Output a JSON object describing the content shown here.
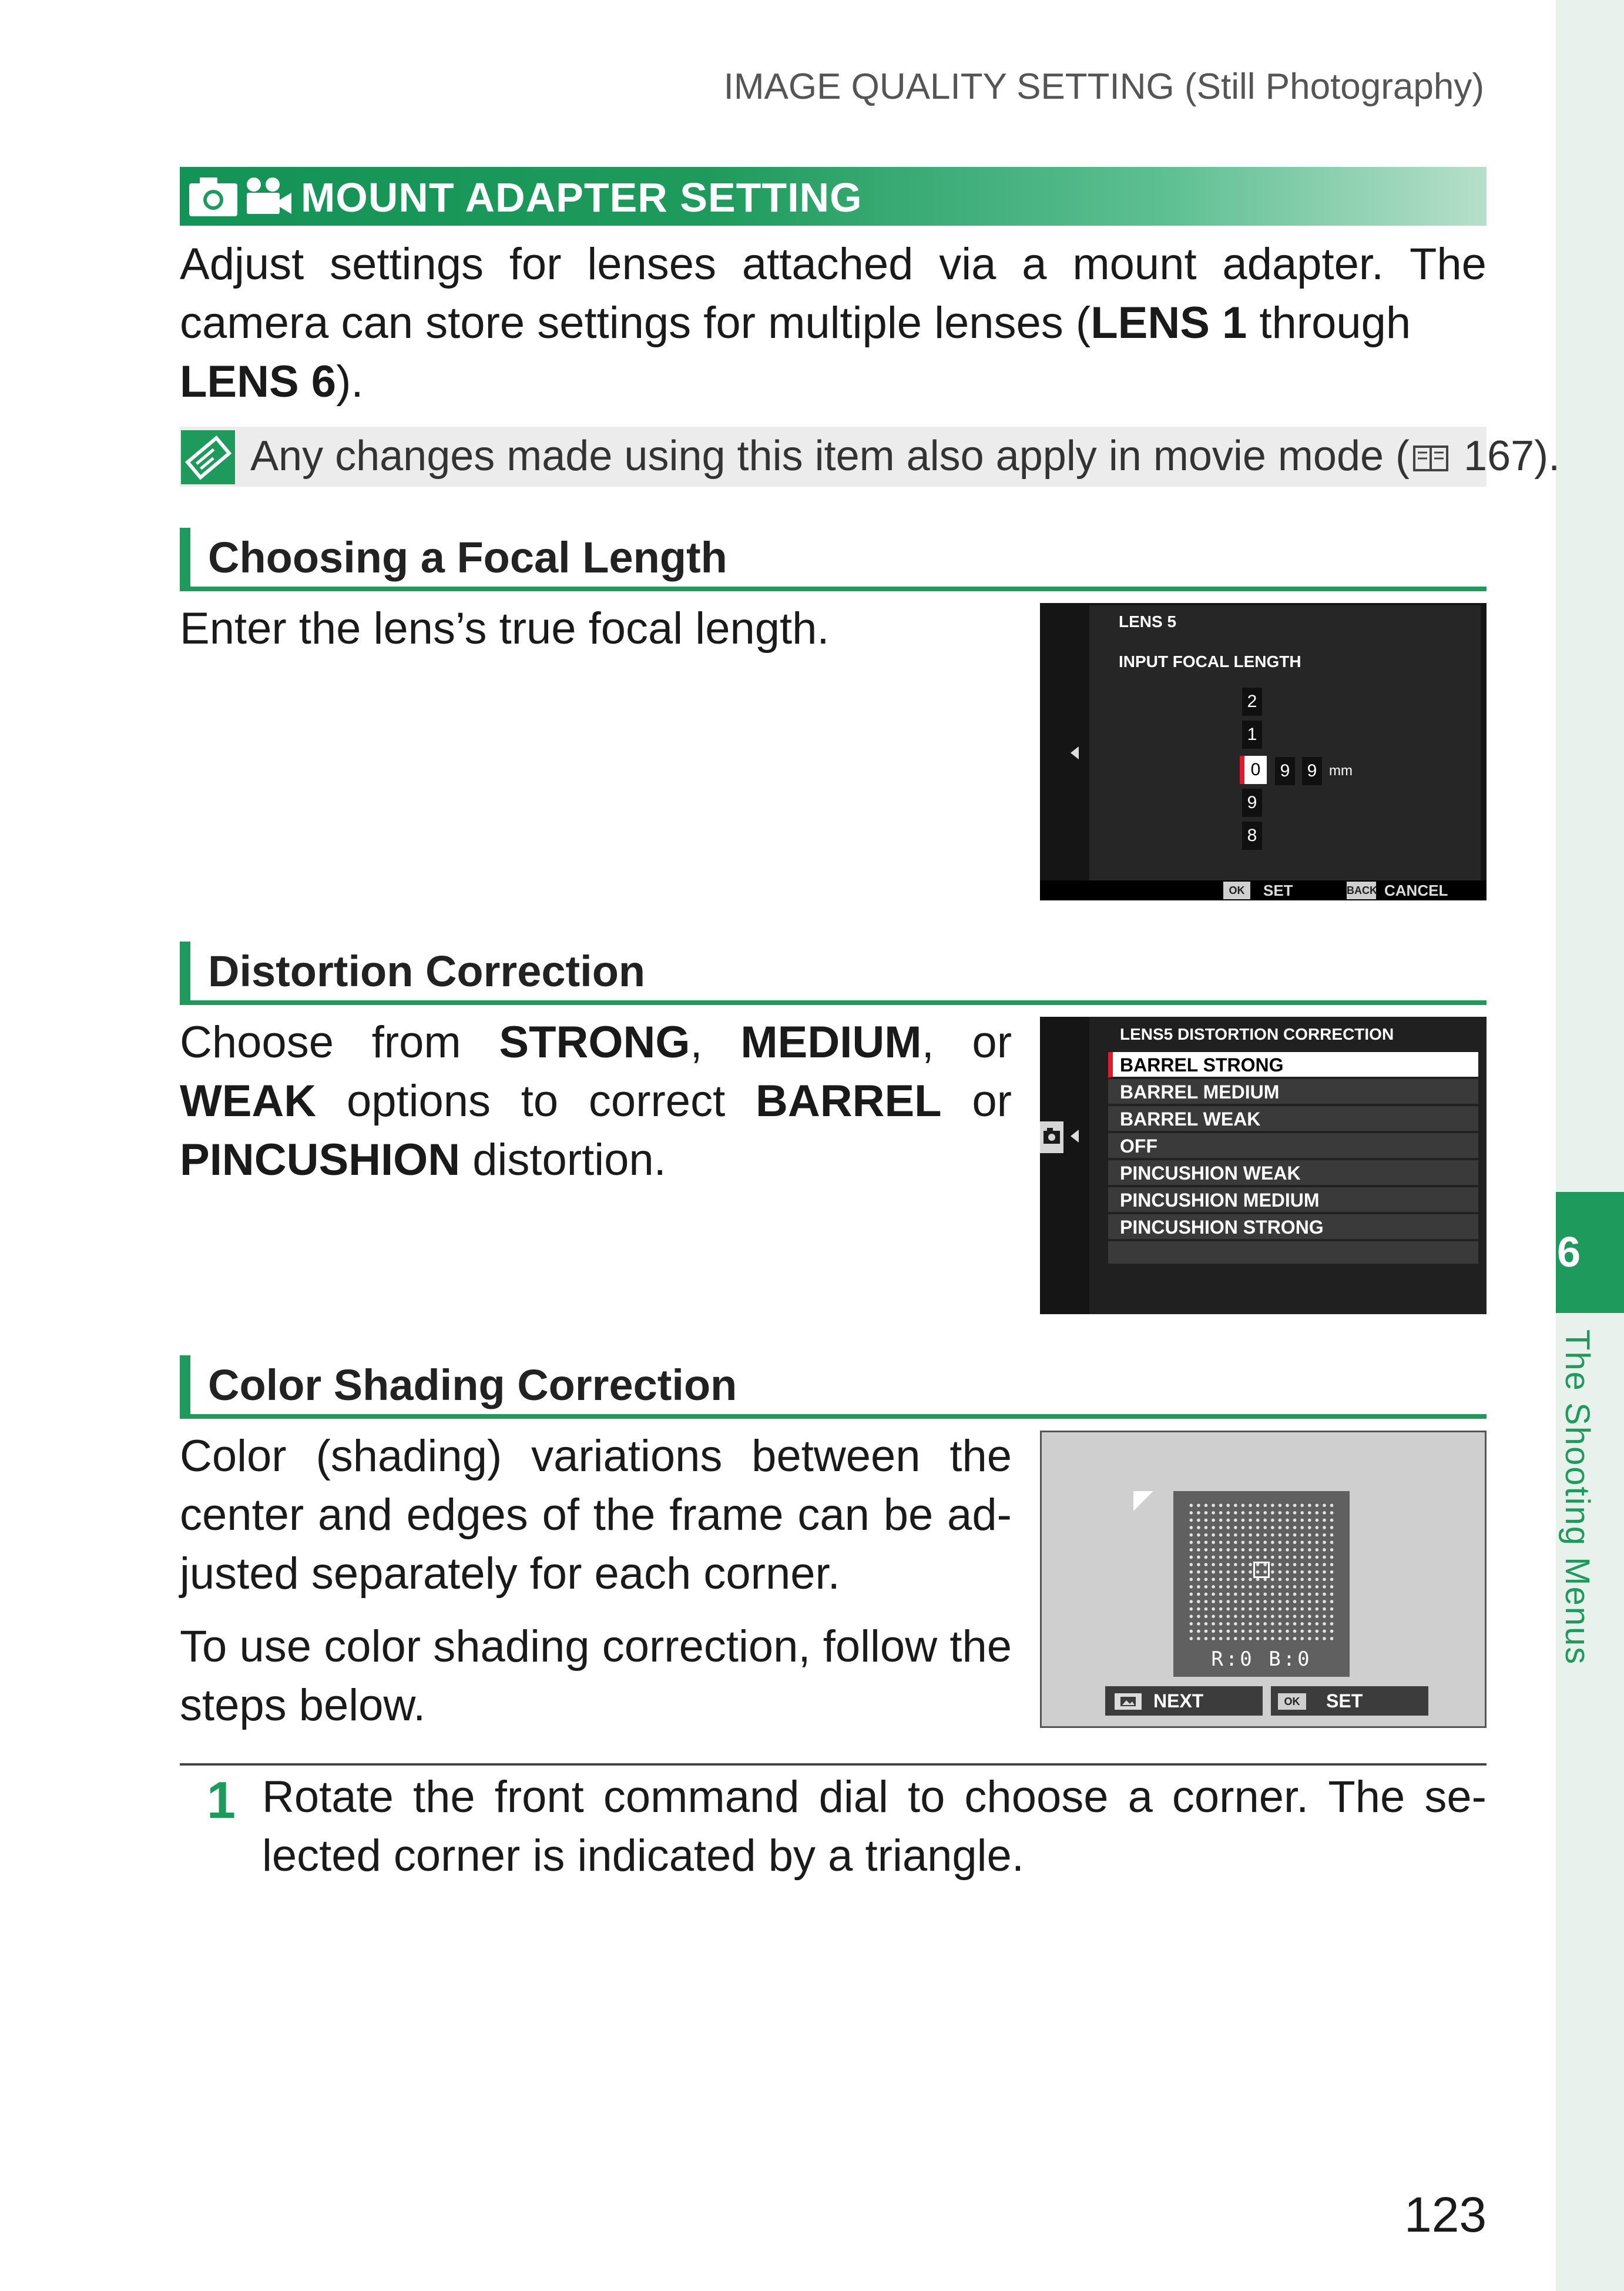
{
  "running_head": "IMAGE QUALITY SETTING (Still Photography)",
  "banner": {
    "title": "MOUNT ADAPTER SETTING",
    "icons": [
      "camera-icon",
      "movie-camera-icon"
    ]
  },
  "intro": {
    "line1": [
      "Adjust",
      "settings",
      "for",
      "lenses",
      "attached",
      "via",
      "a",
      "mount",
      "adapter.",
      "The"
    ],
    "line2_a": "camera can store settings for multiple lenses (",
    "line2_b": "LENS 1",
    "line2_c": " through",
    "line3_a": "LENS 6",
    "line3_b": ")."
  },
  "note": {
    "text_a": "Any changes made using this item also apply in movie mode (",
    "page_ref": "167",
    "text_b": ")."
  },
  "sections": {
    "focal": {
      "heading": "Choosing a Focal Length",
      "body": "Enter the lens’s true focal length."
    },
    "distortion": {
      "heading": "Distortion Correction",
      "l1": {
        "a": "Choose",
        "b": "from",
        "c": "STRONG",
        "d": ",",
        "e": "MEDIUM",
        "f": ",",
        "g": "or"
      },
      "l2": {
        "a": "WEAK",
        "b": "options",
        "c": "to",
        "d": "correct",
        "e": "BARREL",
        "f": "or"
      },
      "l3": {
        "a": "PINCUSHION",
        "b": " distortion."
      }
    },
    "shading": {
      "heading": "Color Shading Correction",
      "l1": [
        "Color",
        "(shading)",
        "variations",
        "between",
        "the"
      ],
      "l2": [
        "center",
        "and",
        "edges",
        "of",
        "the",
        "frame",
        "can",
        "be",
        "ad-"
      ],
      "l3": "justed separately for each corner.",
      "l4": [
        "To",
        "use",
        "color",
        "shading",
        "correction,",
        "follow",
        "the"
      ],
      "l5": "steps below."
    }
  },
  "screen_focal": {
    "lens": "LENS 5",
    "label": "INPUT FOCAL LENGTH",
    "wheel": [
      "2",
      "1",
      "0",
      "9",
      "8"
    ],
    "digits": [
      "9",
      "9"
    ],
    "unit": "mm",
    "ok_key": "OK",
    "ok_label": "SET",
    "back_key": "BACK",
    "back_label": "CANCEL"
  },
  "screen_distortion": {
    "title": "LENS5 DISTORTION CORRECTION",
    "options": [
      "BARREL STRONG",
      "BARREL MEDIUM",
      "BARREL WEAK",
      "OFF",
      "PINCUSHION WEAK",
      "PINCUSHION MEDIUM",
      "PINCUSHION STRONG"
    ],
    "selected_index": 0
  },
  "screen_shading": {
    "readout": "R:0  B:0",
    "next_label": "NEXT",
    "ok_key": "OK",
    "set_label": "SET"
  },
  "steps": [
    {
      "num": "1",
      "l1": [
        "Rotate",
        "the",
        "front",
        "command",
        "dial",
        "to",
        "choose",
        "a",
        "corner.",
        "The",
        "se-"
      ],
      "l2": "lected corner is indicated by a triangle."
    }
  ],
  "chapter": {
    "number": "6",
    "title": "The Shooting Menus"
  },
  "page_number": "123",
  "colors": {
    "accent": "#1e9a5c",
    "highlight_red": "#e0192b"
  }
}
